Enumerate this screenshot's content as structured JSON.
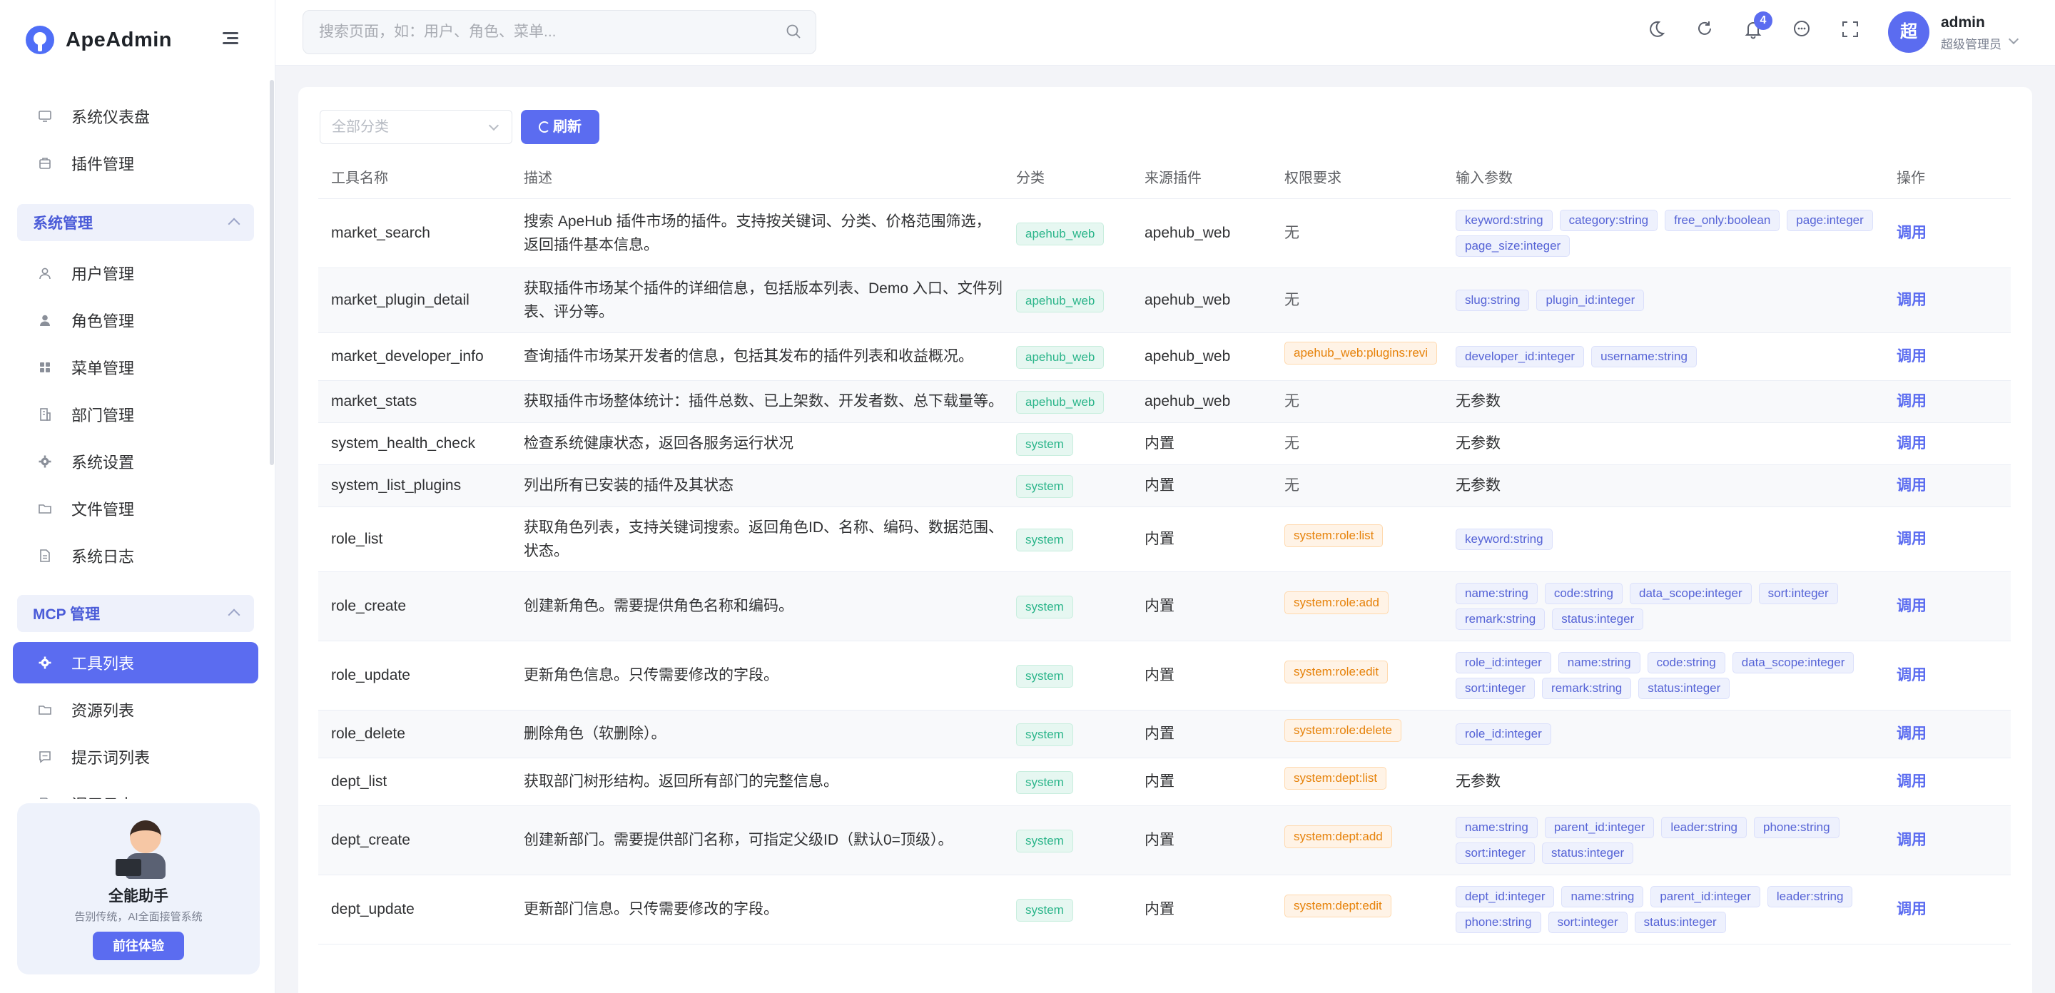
{
  "app": {
    "name": "ApeAdmin"
  },
  "search": {
    "placeholder": "搜索页面，如：用户、角色、菜单..."
  },
  "header": {
    "notification_count": "4"
  },
  "user": {
    "avatar_text": "超",
    "name": "admin",
    "role": "超级管理员"
  },
  "sidebar": {
    "top_items": [
      {
        "label": "系统仪表盘",
        "icon": "monitor-icon"
      },
      {
        "label": "插件管理",
        "icon": "plugin-icon"
      }
    ],
    "groups": [
      {
        "title": "系统管理",
        "items": [
          {
            "label": "用户管理",
            "icon": "user-icon"
          },
          {
            "label": "角色管理",
            "icon": "role-icon"
          },
          {
            "label": "菜单管理",
            "icon": "menu-grid-icon"
          },
          {
            "label": "部门管理",
            "icon": "department-icon"
          },
          {
            "label": "系统设置",
            "icon": "gear-icon"
          },
          {
            "label": "文件管理",
            "icon": "folder-icon"
          },
          {
            "label": "系统日志",
            "icon": "log-icon"
          }
        ]
      },
      {
        "title": "MCP 管理",
        "items": [
          {
            "label": "工具列表",
            "icon": "gear-icon",
            "active": true
          },
          {
            "label": "资源列表",
            "icon": "folder-icon"
          },
          {
            "label": "提示词列表",
            "icon": "chat-icon"
          },
          {
            "label": "调用日志",
            "icon": "log-icon"
          }
        ]
      }
    ]
  },
  "assistant": {
    "title": "全能助手",
    "subtitle": "告别传统，AI全面接管系统",
    "button": "前往体验"
  },
  "filter": {
    "placeholder": "全部分类",
    "refresh_label": "刷新"
  },
  "table": {
    "columns": [
      "工具名称",
      "描述",
      "分类",
      "来源插件",
      "权限要求",
      "输入参数",
      "操作"
    ],
    "action_label": "调用",
    "rows": [
      {
        "name": "market_search",
        "desc": "搜索 ApeHub 插件市场的插件。支持按关键词、分类、价格范围筛选，返回插件基本信息。",
        "category": "apehub_web",
        "source": "apehub_web",
        "perm": "无",
        "params": [
          "keyword:string",
          "category:string",
          "free_only:boolean",
          "page:integer",
          "page_size:integer"
        ]
      },
      {
        "name": "market_plugin_detail",
        "desc": "获取插件市场某个插件的详细信息，包括版本列表、Demo 入口、文件列表、评分等。",
        "category": "apehub_web",
        "source": "apehub_web",
        "perm": "无",
        "params": [
          "slug:string",
          "plugin_id:integer"
        ]
      },
      {
        "name": "market_developer_info",
        "desc": "查询插件市场某开发者的信息，包括其发布的插件列表和收益概况。",
        "category": "apehub_web",
        "source": "apehub_web",
        "perm": "apehub_web:plugins:revi",
        "params": [
          "developer_id:integer",
          "username:string"
        ]
      },
      {
        "name": "market_stats",
        "desc": "获取插件市场整体统计：插件总数、已上架数、开发者数、总下载量等。",
        "category": "apehub_web",
        "source": "apehub_web",
        "perm": "无",
        "params": [],
        "no_params": "无参数"
      },
      {
        "name": "system_health_check",
        "desc": "检查系统健康状态，返回各服务运行状况",
        "category": "system",
        "source": "内置",
        "perm": "无",
        "params": [],
        "no_params": "无参数"
      },
      {
        "name": "system_list_plugins",
        "desc": "列出所有已安装的插件及其状态",
        "category": "system",
        "source": "内置",
        "perm": "无",
        "params": [],
        "no_params": "无参数"
      },
      {
        "name": "role_list",
        "desc": "获取角色列表，支持关键词搜索。返回角色ID、名称、编码、数据范围、状态。",
        "category": "system",
        "source": "内置",
        "perm": "system:role:list",
        "params": [
          "keyword:string"
        ]
      },
      {
        "name": "role_create",
        "desc": "创建新角色。需要提供角色名称和编码。",
        "category": "system",
        "source": "内置",
        "perm": "system:role:add",
        "params": [
          "name:string",
          "code:string",
          "data_scope:integer",
          "sort:integer",
          "remark:string",
          "status:integer"
        ]
      },
      {
        "name": "role_update",
        "desc": "更新角色信息。只传需要修改的字段。",
        "category": "system",
        "source": "内置",
        "perm": "system:role:edit",
        "params": [
          "role_id:integer",
          "name:string",
          "code:string",
          "data_scope:integer",
          "sort:integer",
          "remark:string",
          "status:integer"
        ]
      },
      {
        "name": "role_delete",
        "desc": "删除角色（软删除）。",
        "category": "system",
        "source": "内置",
        "perm": "system:role:delete",
        "params": [
          "role_id:integer"
        ]
      },
      {
        "name": "dept_list",
        "desc": "获取部门树形结构。返回所有部门的完整信息。",
        "category": "system",
        "source": "内置",
        "perm": "system:dept:list",
        "params": [],
        "no_params": "无参数"
      },
      {
        "name": "dept_create",
        "desc": "创建新部门。需要提供部门名称，可指定父级ID（默认0=顶级）。",
        "category": "system",
        "source": "内置",
        "perm": "system:dept:add",
        "params": [
          "name:string",
          "parent_id:integer",
          "leader:string",
          "phone:string",
          "sort:integer",
          "status:integer"
        ]
      },
      {
        "name": "dept_update",
        "desc": "更新部门信息。只传需要修改的字段。",
        "category": "system",
        "source": "内置",
        "perm": "system:dept:edit",
        "params": [
          "dept_id:integer",
          "name:string",
          "parent_id:integer",
          "leader:string",
          "phone:string",
          "sort:integer",
          "status:integer"
        ]
      }
    ]
  }
}
